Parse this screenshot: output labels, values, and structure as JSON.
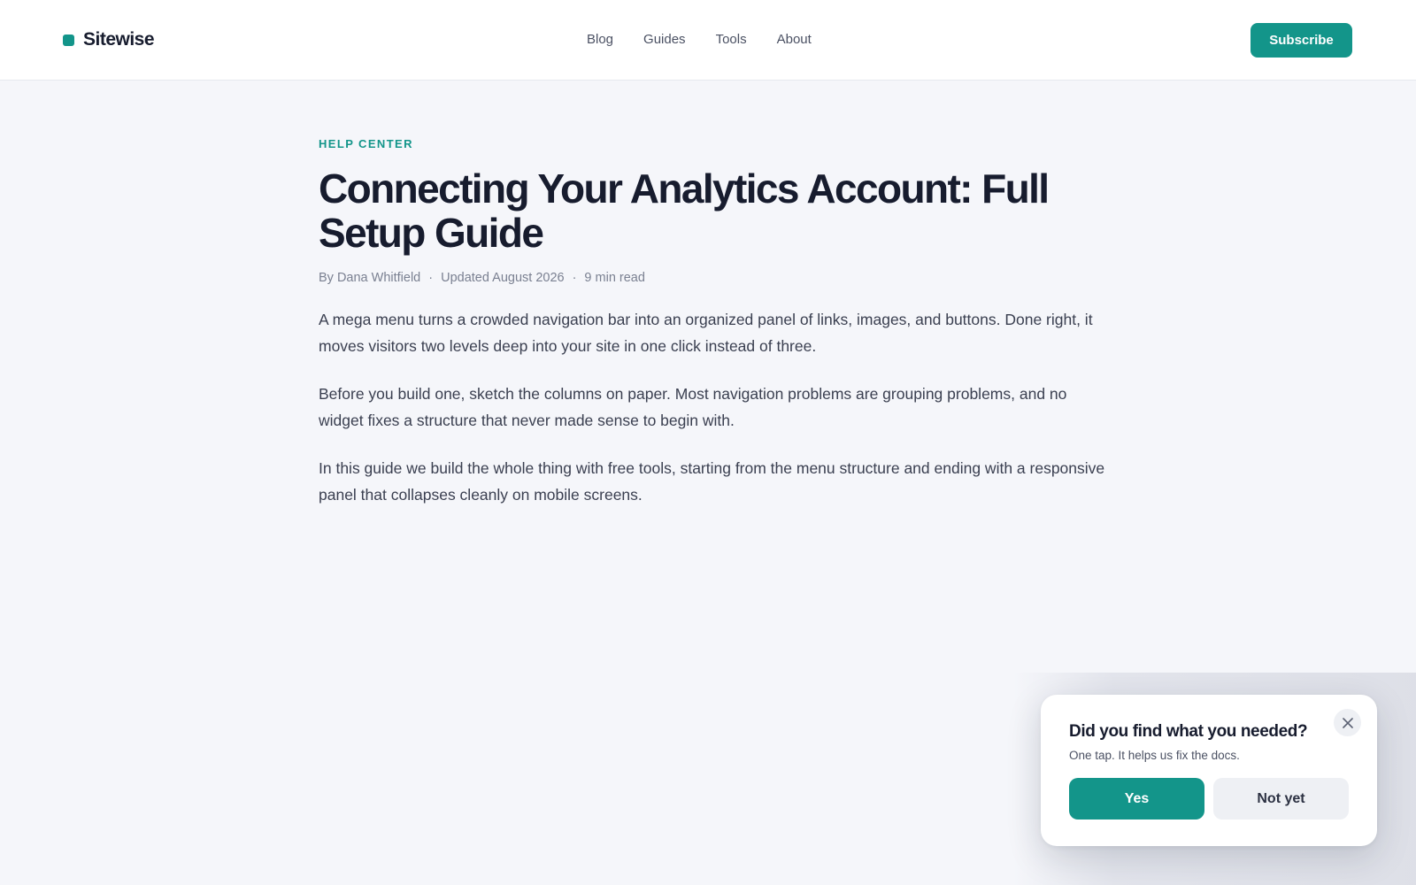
{
  "brand": {
    "name": "Sitewise",
    "accent_color": "#13958a",
    "icon": "brand-dot-icon"
  },
  "nav": {
    "items": [
      {
        "label": "Blog"
      },
      {
        "label": "Guides"
      },
      {
        "label": "Tools"
      },
      {
        "label": "About"
      }
    ],
    "subscribe_label": "Subscribe"
  },
  "article": {
    "kicker": "HELP CENTER",
    "title": "Connecting Your Analytics Account: Full Setup Guide",
    "author": "By Dana Whitfield",
    "updated": "Updated August 2026",
    "read_time": "9 min read",
    "separator": "·",
    "paragraphs": [
      "A mega menu turns a crowded navigation bar into an organized panel of links, images, and buttons. Done right, it moves visitors two levels deep into your site in one click instead of three.",
      "Before you build one, sketch the columns on paper. Most navigation problems are grouping problems, and no widget fixes a structure that never made sense to begin with.",
      "In this guide we build the whole thing with free tools, starting from the menu structure and ending with a responsive panel that collapses cleanly on mobile screens."
    ]
  },
  "feedback": {
    "title": "Did you find what you needed?",
    "subtitle": "One tap. It helps us fix the docs.",
    "yes_label": "Yes",
    "no_label": "Not yet",
    "close_icon": "close-icon"
  }
}
